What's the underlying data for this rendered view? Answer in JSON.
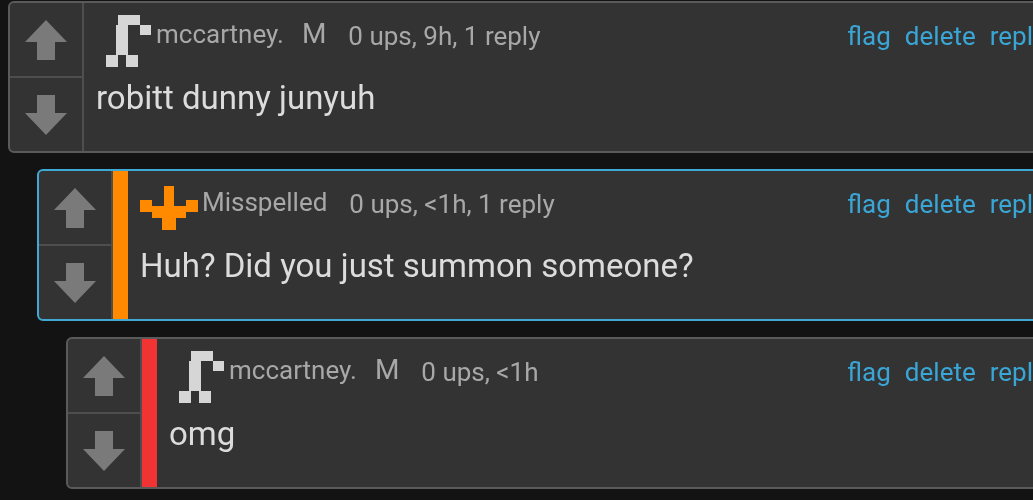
{
  "comments": [
    {
      "kind": "hook",
      "author": "mccartney.",
      "badge": "M",
      "meta": "0 ups, 9h, 1 reply",
      "body": "robitt dunny junyuh",
      "highlighted": false,
      "actions": [
        "flag",
        "delete",
        "repl"
      ],
      "children": [
        {
          "kind": "cross",
          "author": "Misspelled",
          "meta": "0 ups, <1h, 1 reply",
          "body": "Huh? Did you just summon someone?",
          "highlighted": true,
          "color": "#ff8a00",
          "actions": [
            "flag",
            "delete",
            "repl"
          ],
          "children": [
            {
              "kind": "hook",
              "author": "mccartney.",
              "badge": "M",
              "meta": "0 ups, <1h",
              "body": "omg",
              "highlighted": false,
              "color": "#f23333",
              "actions": [
                "flag",
                "delete",
                "repl"
              ]
            }
          ]
        }
      ]
    }
  ]
}
